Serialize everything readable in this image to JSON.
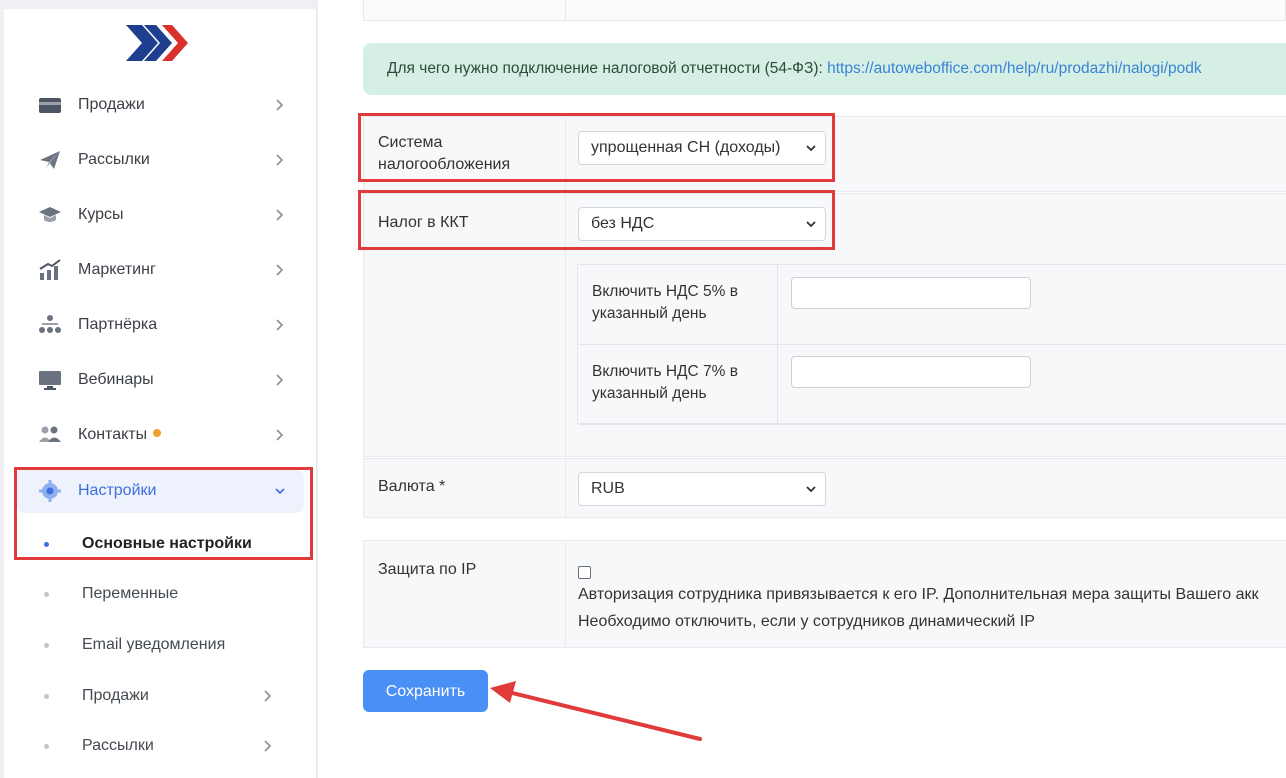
{
  "sidebar": {
    "items": [
      {
        "label": "Продажи",
        "icon": "card-icon"
      },
      {
        "label": "Рассылки",
        "icon": "paper-plane-icon"
      },
      {
        "label": "Курсы",
        "icon": "graduation-cap-icon"
      },
      {
        "label": "Маркетинг",
        "icon": "growth-chart-icon"
      },
      {
        "label": "Партнёрка",
        "icon": "hierarchy-icon"
      },
      {
        "label": "Вебинары",
        "icon": "monitor-icon"
      },
      {
        "label": "Контакты",
        "icon": "people-icon"
      },
      {
        "label": "Настройки",
        "icon": "gear-icon"
      }
    ],
    "subitems": [
      {
        "label": "Основные настройки"
      },
      {
        "label": "Переменные"
      },
      {
        "label": "Email уведомления"
      },
      {
        "label": "Продажи"
      },
      {
        "label": "Рассылки"
      }
    ]
  },
  "main": {
    "info_text": "Для чего нужно подключение налоговой отчетности (54-ФЗ): ",
    "info_link": "https://autoweboffice.com/help/ru/prodazhi/nalogi/podk",
    "tax_system": {
      "label_line1": "Система",
      "label_line2": "налогообложения",
      "value": "упрощенная СН (доходы)"
    },
    "kkt_tax": {
      "label": "Налог в ККТ",
      "value": "без НДС"
    },
    "vat5": {
      "label_line1": "Включить НДС 5% в",
      "label_line2": "указанный день",
      "value": ""
    },
    "vat7": {
      "label_line1": "Включить НДС 7% в",
      "label_line2": "указанный день",
      "value": ""
    },
    "currency": {
      "label": "Валюта *",
      "value": "RUB"
    },
    "ip_protect": {
      "label": "Защита по IP",
      "checked": false,
      "help_line1": "Авторизация сотрудника привязывается к его IP. Дополнительная мера защиты Вашего акк",
      "help_line2": "Необходимо отключить, если у сотрудников динамический IP"
    },
    "save_label": "Сохранить"
  },
  "colors": {
    "accent": "#4a8ff5",
    "highlight": "#e03a3a",
    "info_bg": "#d5efe5"
  }
}
